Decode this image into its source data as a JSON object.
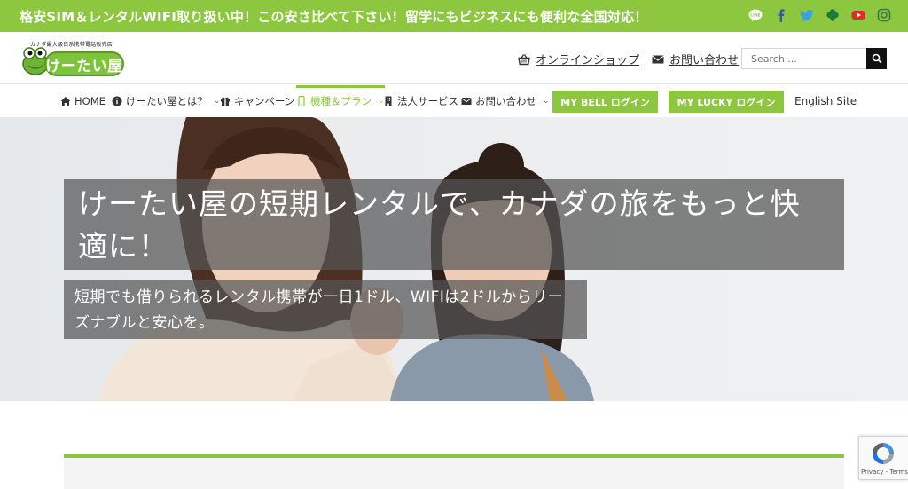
{
  "topbar": {
    "message": "格安SIM＆レンタルWIFI取り扱い中！この安さ比べて下さい！留学にもビジネスにも便利な全国対応！",
    "social_icons": [
      "line-icon",
      "facebook-icon",
      "twitter-icon",
      "clover-icon",
      "youtube-icon",
      "instagram-icon"
    ]
  },
  "header": {
    "logo": {
      "tagline": "カナダ最大級日系携帯電話販売店",
      "name": "けーたい屋"
    },
    "links": {
      "shop": "オンラインショップ",
      "contact": "お問い合わせ"
    },
    "search": {
      "placeholder": "Search ..."
    }
  },
  "nav": {
    "items": [
      {
        "label": "HOME"
      },
      {
        "label": "けーたい屋とは？"
      },
      {
        "label": "キャンペーン"
      },
      {
        "label": "機種＆プラン"
      },
      {
        "label": "法人サービス"
      },
      {
        "label": "お問い合わせ"
      }
    ],
    "bell_login": "MY BELL ログイン",
    "lucky_login": "MY LUCKY ログイン",
    "english": "English Site"
  },
  "hero": {
    "title": "けーたい屋の短期レンタルで、カナダの旅をもっと快適に！",
    "subtitle": "短期でも借りられるレンタル携帯が一日1ドル、WIFIは2ドルからリーズナブルと安心を。"
  },
  "recaptcha": {
    "footer": "Privacy - Terms"
  },
  "colors": {
    "brand_green": "#8dc63f",
    "overlay_gray": "#555555"
  }
}
